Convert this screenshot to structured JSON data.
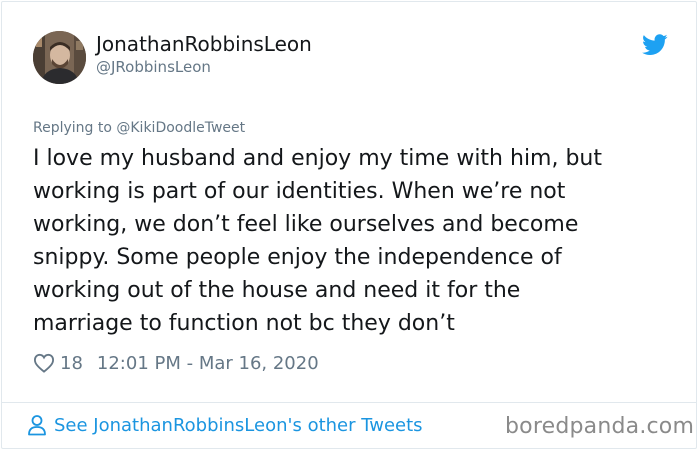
{
  "author": {
    "display_name": "JonathanRobbinsLeon",
    "handle": "@JRobbinsLeon"
  },
  "reply": {
    "text": "Replying to @KikiDoodleTweet"
  },
  "tweet": {
    "lines": [
      "I love my husband and enjoy my time with him, but",
      "working is part of our identities. When we’re not",
      "working, we don’t feel like ourselves and become",
      "snippy. Some people enjoy the independence of",
      "working out of the house and need it for the",
      "marriage to function not bc they don’t"
    ]
  },
  "meta": {
    "likes": "18",
    "timestamp": "12:01 PM - Mar 16, 2020"
  },
  "footer": {
    "see_more": "See JonathanRobbinsLeon's other Tweets",
    "watermark": "boredpanda.com"
  },
  "colors": {
    "twitter_blue": "#1da1f2",
    "link_blue": "#1b95e0",
    "secondary_text": "#657786",
    "border": "#e1e8ed"
  },
  "icons": {
    "brand": "twitter-bird-icon",
    "like": "heart-icon",
    "profile": "person-icon"
  }
}
